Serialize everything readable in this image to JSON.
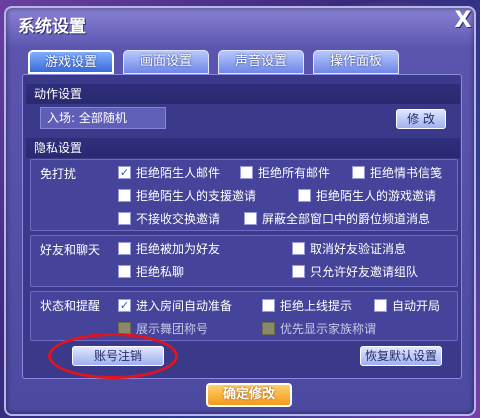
{
  "window": {
    "title": "系统设置",
    "close_glyph": "X"
  },
  "tabs": [
    {
      "label": "游戏设置",
      "active": true
    },
    {
      "label": "画面设置",
      "active": false
    },
    {
      "label": "声音设置",
      "active": false
    },
    {
      "label": "操作面板",
      "active": false
    }
  ],
  "action": {
    "header": "动作设置",
    "entry_value": "入场: 全部随机",
    "modify_label": "修 改"
  },
  "privacy": {
    "header": "隐私设置",
    "disturb": {
      "label": "免打扰",
      "options": [
        {
          "label": "拒绝陌生人邮件",
          "checked": true
        },
        {
          "label": "拒绝所有邮件",
          "checked": false
        },
        {
          "label": "拒绝情书信笺",
          "checked": false
        },
        {
          "label": "拒绝陌生人的支援邀请",
          "checked": false
        },
        {
          "label": "拒绝陌生人的游戏邀请",
          "checked": false
        },
        {
          "label": "不接收交换邀请",
          "checked": false
        },
        {
          "label": "屏蔽全部窗口中的爵位频道消息",
          "checked": false
        }
      ]
    },
    "friends": {
      "label": "好友和聊天",
      "options": [
        {
          "label": "拒绝被加为好友",
          "checked": false
        },
        {
          "label": "取消好友验证消息",
          "checked": false
        },
        {
          "label": "拒绝私聊",
          "checked": false
        },
        {
          "label": "只允许好友邀请组队",
          "checked": false
        }
      ]
    },
    "status": {
      "label": "状态和提醒",
      "options": [
        {
          "label": "进入房间自动准备",
          "checked": true,
          "disabled": false
        },
        {
          "label": "拒绝上线提示",
          "checked": false,
          "disabled": false
        },
        {
          "label": "自动开局",
          "checked": false,
          "disabled": false
        },
        {
          "label": "展示舞团称号",
          "checked": false,
          "disabled": true
        },
        {
          "label": "优先显示家族称谓",
          "checked": false,
          "disabled": true
        }
      ]
    }
  },
  "buttons": {
    "account_cancel": "账号注销",
    "restore_defaults": "恢复默认设置",
    "confirm": "确定修改"
  },
  "colors": {
    "annotation": "#e0141e",
    "confirm": "#f39a1c",
    "checkmark": "#2a58d8"
  }
}
